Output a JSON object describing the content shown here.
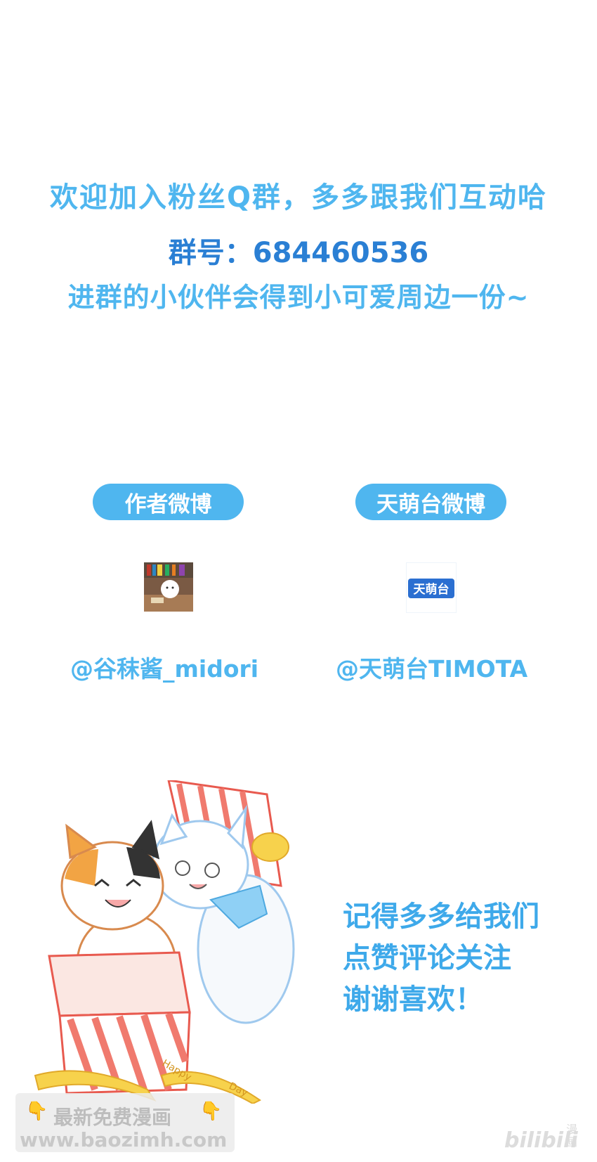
{
  "intro": {
    "line1": "欢迎加入粉丝Q群，多多跟我们互动哈",
    "line2": "群号：684460536",
    "line3": "进群的小伙伴会得到小可爱周边一份~"
  },
  "social": {
    "author_label": "作者微博",
    "studio_label": "天萌台微博",
    "author_handle": "@谷秣酱_midori",
    "studio_handle": "@天萌台TIMOTA",
    "studio_logo_text": "天萌台"
  },
  "closing": {
    "line1": "记得多多给我们",
    "line2": "点赞评论关注",
    "line3": "谢谢喜欢！"
  },
  "illustration": {
    "ribbon_text_left": "Happy",
    "ribbon_text_right": "Day"
  },
  "watermark": {
    "title": "最新免费漫画",
    "url": "www.baozimh.com",
    "hand_icon": "👇"
  },
  "bilibili": {
    "logo": "bilibili",
    "sub": "漫画"
  },
  "colors": {
    "accent": "#4fb6ef",
    "accent_dark": "#2a7fd4",
    "box_red": "#f0695a"
  }
}
